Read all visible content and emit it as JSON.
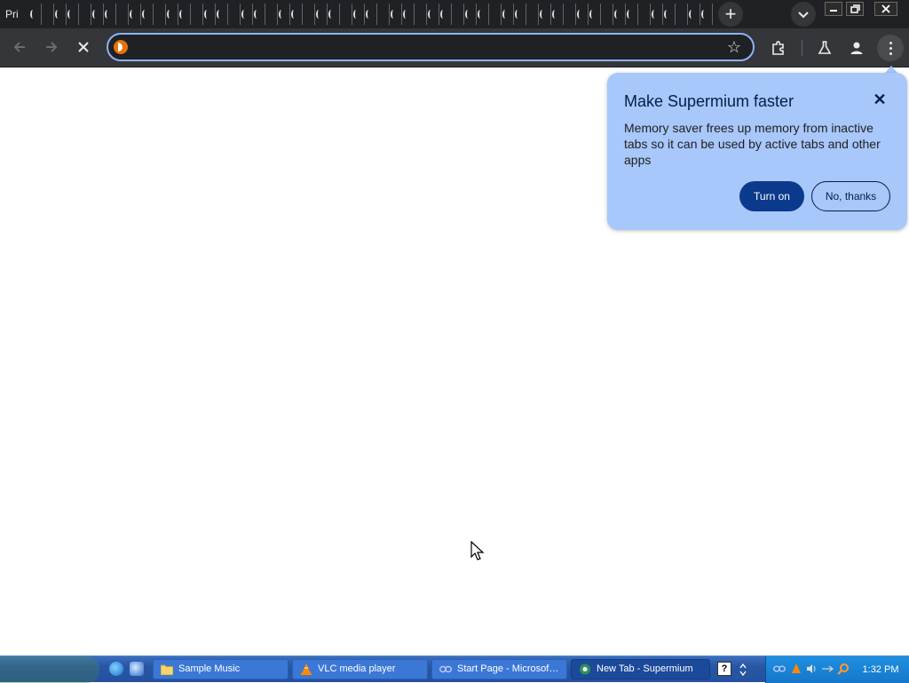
{
  "tabstrip": {
    "first_tab_label": "Pri",
    "new_tab_symbol": "+"
  },
  "toolbar": {
    "omnibox_value": "",
    "star_symbol": "☆"
  },
  "bubble": {
    "title": "Make Supermium faster",
    "body": "Memory saver frees up memory from inactive tabs so it can be used by active tabs and other apps",
    "primary_label": "Turn on",
    "secondary_label": "No, thanks",
    "close_symbol": "✕"
  },
  "taskbar": {
    "buttons": [
      {
        "label": "Sample Music",
        "icon": "folder-icon"
      },
      {
        "label": "VLC media player",
        "icon": "vlc-icon"
      },
      {
        "label": "Start Page - Microsof…",
        "icon": "opera-icon"
      },
      {
        "label": "New Tab - Supermium",
        "icon": "supermium-icon"
      }
    ],
    "clock": "1:32 PM"
  },
  "colors": {
    "bubble_bg": "#a8c7fa",
    "primary_button": "#0b3a8c",
    "tabstrip_bg": "#202124",
    "toolbar_bg": "#35363a",
    "omnibox_focus": "#8ab4f8"
  }
}
